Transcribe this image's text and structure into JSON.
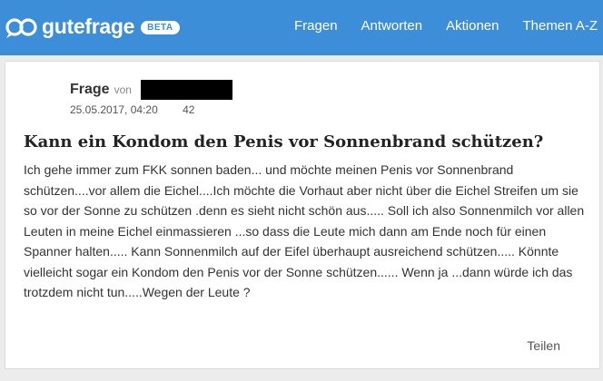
{
  "header": {
    "logo_text": "gutefrage",
    "beta": "BETA",
    "brand_color": "#3d8ed8",
    "nav": [
      {
        "label": "Fragen"
      },
      {
        "label": "Antworten"
      },
      {
        "label": "Aktionen"
      },
      {
        "label": "Themen A-Z"
      }
    ]
  },
  "question": {
    "type_label": "Frage",
    "by_label": "von",
    "date": "25.05.2017, 04:20",
    "answer_count": "42",
    "title": "Kann ein Kondom den Penis vor Sonnenbrand schützen?",
    "body": "Ich gehe immer zum FKK sonnen baden... und möchte meinen Penis vor Sonnenbrand schützen....vor allem die Eichel....Ich möchte die Vorhaut aber nicht über die Eichel Streifen um sie so vor der Sonne zu schützen .denn es sieht nicht schön aus..... Soll ich also Sonnenmilch vor allen Leuten in meine Eichel einmassieren ...so dass die Leute mich dann am Ende noch für einen Spanner halten..... Kann Sonnenmilch auf der Eifel überhaupt ausreichend schützen..... Könnte vielleicht sogar ein Kondom den Penis vor der Sonne schützen...... Wenn ja ...dann würde ich das trotzdem nicht tun.....Wegen der Leute ?",
    "share_label": "Teilen"
  }
}
